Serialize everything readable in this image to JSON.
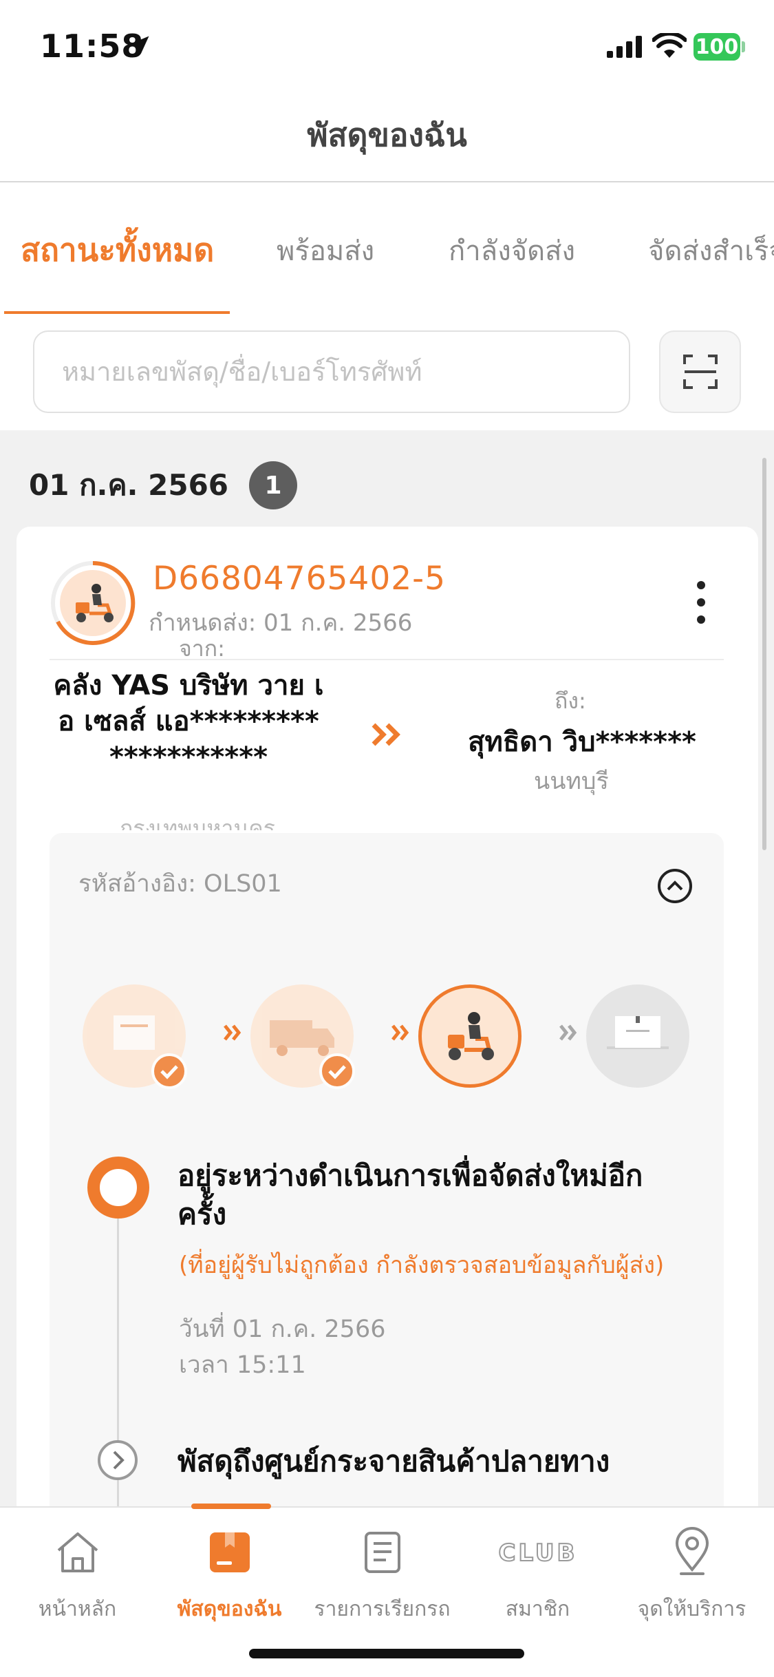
{
  "status_bar": {
    "time": "11:58",
    "battery": "100"
  },
  "header": {
    "title": "พัสดุของฉัน"
  },
  "tabs": [
    {
      "label": "สถานะทั้งหมด",
      "active": true
    },
    {
      "label": "พร้อมส่ง",
      "active": false
    },
    {
      "label": "กำลังจัดส่ง",
      "active": false
    },
    {
      "label": "จัดส่งสำเร็จ",
      "active": false
    }
  ],
  "search": {
    "placeholder": "หมายเลขพัสดุ/ชื่อ/เบอร์โทรศัพท์",
    "value": ""
  },
  "group": {
    "date": "01 ก.ค. 2566",
    "count": "1"
  },
  "parcel": {
    "tracking": "D66804765402-5",
    "due": "กำหนดส่ง: 01 ก.ค. 2566",
    "from_label": "จาก:",
    "sender": "คลัง YAS บริษัท วาย เอ เซลส์ แอ********************",
    "sender_city": "กรุงเทพมหานคร",
    "to_label": "ถึง:",
    "receiver": "สุทธิดา วิบ*******",
    "receiver_city": "นนทบุรี",
    "reference": "รหัสอ้างอิง: OLS01",
    "timeline": [
      {
        "title": "อยู่ระหว่างดำเนินการเพื่อจัดส่งใหม่อีกครั้ง",
        "note": "(ที่อยู่ผู้รับไม่ถูกต้อง กำลังตรวจสอบข้อมูลกับผู้ส่ง)",
        "date": "วันที่ 01 ก.ค. 2566",
        "time": "เวลา 15:11"
      },
      {
        "title": "พัสดุถึงศูนย์กระจายสินค้าปลายทาง"
      }
    ]
  },
  "nav": [
    {
      "label": "หน้าหลัก",
      "icon": "home-icon",
      "active": false
    },
    {
      "label": "พัสดุของฉัน",
      "icon": "parcel-icon",
      "active": true
    },
    {
      "label": "รายการเรียกรถ",
      "icon": "list-icon",
      "active": false
    },
    {
      "label": "สมาชิก",
      "icon": "club-icon",
      "active": false,
      "logo_text": "CLUB"
    },
    {
      "label": "จุดให้บริการ",
      "icon": "location-pin-icon",
      "active": false
    }
  ],
  "colors": {
    "accent": "#ef7b2d",
    "background": "#f1f1f1"
  }
}
